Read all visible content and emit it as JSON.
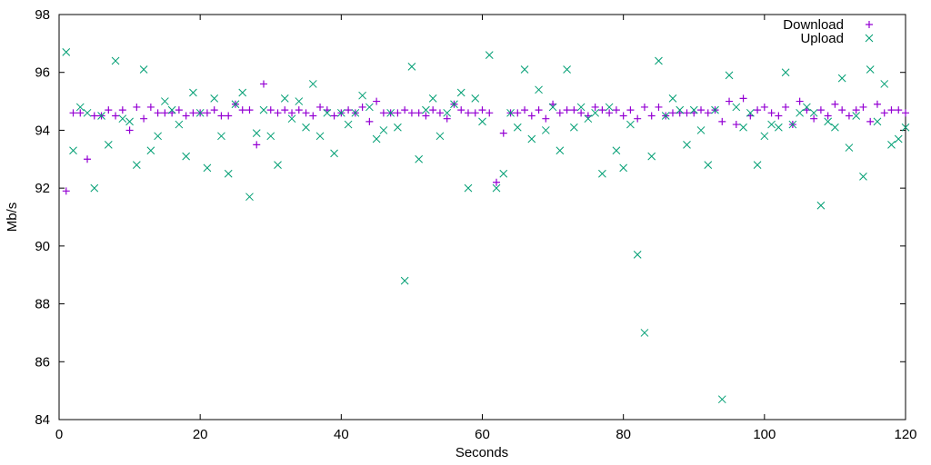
{
  "chart_data": {
    "type": "scatter",
    "title": "",
    "xlabel": "Seconds",
    "ylabel": "Mb/s",
    "xlim": [
      0,
      120
    ],
    "ylim": [
      84,
      98
    ],
    "xticks": [
      0,
      20,
      40,
      60,
      80,
      100,
      120
    ],
    "yticks": [
      84,
      86,
      88,
      90,
      92,
      94,
      96,
      98
    ],
    "grid": false,
    "legend_position": "top-right",
    "series": [
      {
        "name": "Download",
        "marker": "plus",
        "color": "#9400d3",
        "x": [
          1,
          2,
          3,
          4,
          5,
          6,
          7,
          8,
          9,
          10,
          11,
          12,
          13,
          14,
          15,
          16,
          17,
          18,
          19,
          20,
          21,
          22,
          23,
          24,
          25,
          26,
          27,
          28,
          29,
          30,
          31,
          32,
          33,
          34,
          35,
          36,
          37,
          38,
          39,
          40,
          41,
          42,
          43,
          44,
          45,
          46,
          47,
          48,
          49,
          50,
          51,
          52,
          53,
          54,
          55,
          56,
          57,
          58,
          59,
          60,
          61,
          62,
          63,
          64,
          65,
          66,
          67,
          68,
          69,
          70,
          71,
          72,
          73,
          74,
          75,
          76,
          77,
          78,
          79,
          80,
          81,
          82,
          83,
          84,
          85,
          86,
          87,
          88,
          89,
          90,
          91,
          92,
          93,
          94,
          95,
          96,
          97,
          98,
          99,
          100,
          101,
          102,
          103,
          104,
          105,
          106,
          107,
          108,
          109,
          110,
          111,
          112,
          113,
          114,
          115,
          116,
          117,
          118,
          119,
          120
        ],
        "values": [
          91.9,
          94.6,
          94.6,
          93.0,
          94.5,
          94.5,
          94.7,
          94.5,
          94.7,
          94.0,
          94.8,
          94.4,
          94.8,
          94.6,
          94.6,
          94.6,
          94.7,
          94.5,
          94.6,
          94.6,
          94.6,
          94.7,
          94.5,
          94.5,
          94.9,
          94.7,
          94.7,
          93.5,
          95.6,
          94.7,
          94.6,
          94.7,
          94.6,
          94.7,
          94.6,
          94.5,
          94.8,
          94.7,
          94.5,
          94.6,
          94.7,
          94.6,
          94.8,
          94.3,
          95.0,
          94.6,
          94.6,
          94.6,
          94.7,
          94.6,
          94.6,
          94.5,
          94.7,
          94.6,
          94.4,
          94.9,
          94.7,
          94.6,
          94.6,
          94.7,
          94.6,
          92.2,
          93.9,
          94.6,
          94.6,
          94.7,
          94.5,
          94.7,
          94.4,
          94.9,
          94.6,
          94.7,
          94.7,
          94.6,
          94.5,
          94.8,
          94.7,
          94.6,
          94.7,
          94.5,
          94.7,
          94.4,
          94.8,
          94.5,
          94.8,
          94.5,
          94.6,
          94.6,
          94.6,
          94.6,
          94.7,
          94.6,
          94.7,
          94.3,
          95.0,
          94.2,
          95.1,
          94.5,
          94.7,
          94.8,
          94.6,
          94.5,
          94.8,
          94.2,
          95.0,
          94.7,
          94.4,
          94.7,
          94.5,
          94.9,
          94.7,
          94.5,
          94.7,
          94.8,
          94.3,
          94.9,
          94.6,
          94.7,
          94.7,
          94.6
        ]
      },
      {
        "name": "Upload",
        "marker": "cross",
        "color": "#009e73",
        "x": [
          1,
          2,
          3,
          4,
          5,
          6,
          7,
          8,
          9,
          10,
          11,
          12,
          13,
          14,
          15,
          16,
          17,
          18,
          19,
          20,
          21,
          22,
          23,
          24,
          25,
          26,
          27,
          28,
          29,
          30,
          31,
          32,
          33,
          34,
          35,
          36,
          37,
          38,
          39,
          40,
          41,
          42,
          43,
          44,
          45,
          46,
          47,
          48,
          49,
          50,
          51,
          52,
          53,
          54,
          55,
          56,
          57,
          58,
          59,
          60,
          61,
          62,
          63,
          64,
          65,
          66,
          67,
          68,
          69,
          70,
          71,
          72,
          73,
          74,
          75,
          76,
          77,
          78,
          79,
          80,
          81,
          82,
          83,
          84,
          85,
          86,
          87,
          88,
          89,
          90,
          91,
          92,
          93,
          94,
          95,
          96,
          97,
          98,
          99,
          100,
          101,
          102,
          103,
          104,
          105,
          106,
          107,
          108,
          109,
          110,
          111,
          112,
          113,
          114,
          115,
          116,
          117,
          118,
          119,
          120
        ],
        "values": [
          96.7,
          93.3,
          94.8,
          94.6,
          92.0,
          94.5,
          93.5,
          96.4,
          94.4,
          94.3,
          92.8,
          96.1,
          93.3,
          93.8,
          95.0,
          94.7,
          94.2,
          93.1,
          95.3,
          94.6,
          92.7,
          95.1,
          93.8,
          92.5,
          94.9,
          95.3,
          91.7,
          93.9,
          94.7,
          93.8,
          92.8,
          95.1,
          94.4,
          95.0,
          94.1,
          95.6,
          93.8,
          94.6,
          93.2,
          94.6,
          94.2,
          94.6,
          95.2,
          94.8,
          93.7,
          94.0,
          94.6,
          94.1,
          88.8,
          96.2,
          93.0,
          94.7,
          95.1,
          93.8,
          94.6,
          94.9,
          95.3,
          92.0,
          95.1,
          94.3,
          96.6,
          92.0,
          92.5,
          94.6,
          94.1,
          96.1,
          93.7,
          95.4,
          94.0,
          94.8,
          93.3,
          96.1,
          94.1,
          94.8,
          94.4,
          94.6,
          92.5,
          94.8,
          93.3,
          92.7,
          94.2,
          89.7,
          87.0,
          93.1,
          96.4,
          94.5,
          95.1,
          94.7,
          93.5,
          94.7,
          94.0,
          92.8,
          94.7,
          84.7,
          95.9,
          94.8,
          94.1,
          94.6,
          92.8,
          93.8,
          94.2,
          94.1,
          96.0,
          94.2,
          94.6,
          94.8,
          94.6,
          91.4,
          94.3,
          94.1,
          95.8,
          93.4,
          94.5,
          92.4,
          96.1,
          94.3,
          95.6,
          93.5,
          93.7,
          94.1
        ]
      }
    ]
  }
}
